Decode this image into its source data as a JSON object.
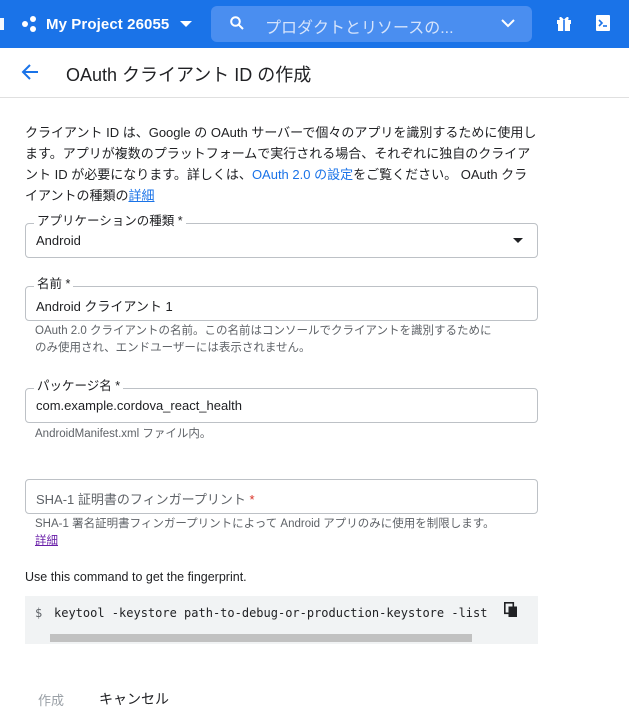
{
  "topbar": {
    "project_name": "My Project 26055",
    "search_placeholder": "プロダクトとリソースの..."
  },
  "header": {
    "title": "OAuth クライアント ID の作成"
  },
  "intro": {
    "text_1": "クライアント ID は、Google の OAuth サーバーで個々のアプリを識別するために使用します。アプリが複数のプラットフォームで実行される場合、それぞれに独自のクライアント ID が必要になります。詳しくは、",
    "link_settings": "OAuth 2.0 の設定",
    "text_2": "をご覧ください。 OAuth クライアントの種類の",
    "link_details": "詳細"
  },
  "form": {
    "app_type": {
      "label": "アプリケーションの種類",
      "required_mark": " *",
      "value": "Android"
    },
    "name": {
      "label": "名前",
      "required_mark": " *",
      "value": "Android クライアント 1",
      "hint_line1": "OAuth 2.0 クライアントの名前。この名前はコンソールでクライアントを識別するために",
      "hint_line2": "のみ使用され、エンドユーザーには表示されません。"
    },
    "package": {
      "label": "パッケージ名",
      "required_mark": " *",
      "value": "com.example.cordova_react_health",
      "hint": "AndroidManifest.xml ファイル内。"
    },
    "sha1": {
      "placeholder": "SHA-1 証明書のフィンガープリント",
      "required_mark": " *",
      "hint": "SHA-1 署名証明書フィンガープリントによって Android アプリのみに使用を制限します。",
      "hint_link": "詳細"
    }
  },
  "command": {
    "label": "Use this command to get the fingerprint.",
    "prompt": "$",
    "text": "keytool -keystore path-to-debug-or-production-keystore -list"
  },
  "actions": {
    "create": "作成",
    "cancel": "キャンセル"
  },
  "colors": {
    "brand_blue": "#1a73e8",
    "required_red": "#d93025"
  }
}
